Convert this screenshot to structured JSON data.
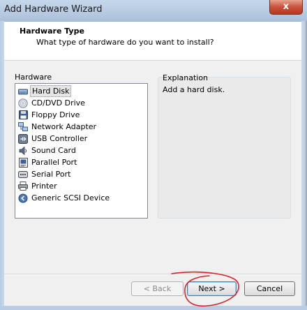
{
  "window": {
    "title": "Add Hardware Wizard",
    "close_glyph": "x"
  },
  "header": {
    "title": "Hardware Type",
    "subtitle": "What type of hardware do you want to install?"
  },
  "hardware_list": {
    "label": "Hardware",
    "selected": "Hard Disk",
    "items": [
      {
        "label": "Hard Disk",
        "icon": "hard-disk-icon"
      },
      {
        "label": "CD/DVD Drive",
        "icon": "cd-dvd-icon"
      },
      {
        "label": "Floppy Drive",
        "icon": "floppy-icon"
      },
      {
        "label": "Network Adapter",
        "icon": "network-adapter-icon"
      },
      {
        "label": "USB Controller",
        "icon": "usb-icon"
      },
      {
        "label": "Sound Card",
        "icon": "sound-card-icon"
      },
      {
        "label": "Parallel Port",
        "icon": "parallel-port-icon"
      },
      {
        "label": "Serial Port",
        "icon": "serial-port-icon"
      },
      {
        "label": "Printer",
        "icon": "printer-icon"
      },
      {
        "label": "Generic SCSI Device",
        "icon": "scsi-icon"
      }
    ]
  },
  "explanation": {
    "label": "Explanation",
    "text": "Add a hard disk."
  },
  "buttons": {
    "back": "< Back",
    "next": "Next >",
    "cancel": "Cancel"
  },
  "colors": {
    "annotation": "#d8232a",
    "titlebar": "#b7cbe2",
    "dialog_bg": "#f0f0f0"
  }
}
